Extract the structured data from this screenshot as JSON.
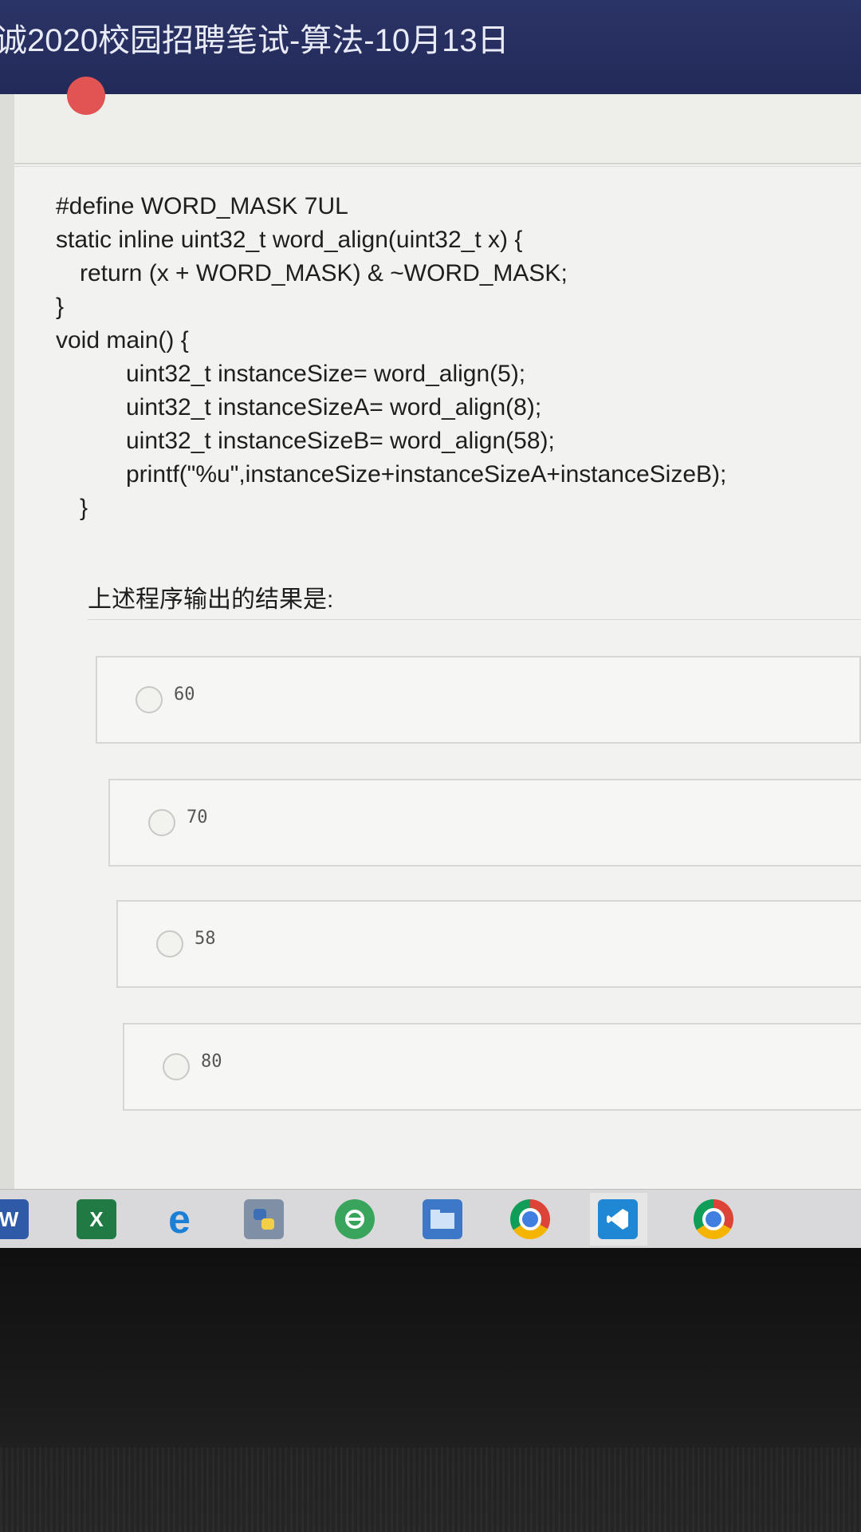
{
  "window": {
    "title": "诚2020校园招聘笔试-算法-10月13日"
  },
  "code_lines": [
    "#define WORD_MASK 7UL",
    "static inline uint32_t word_align(uint32_t x) {",
    "return (x + WORD_MASK) & ~WORD_MASK;",
    "}",
    "void main() {",
    "uint32_t instanceSize= word_align(5);",
    "uint32_t instanceSizeA= word_align(8);",
    "uint32_t instanceSizeB= word_align(58);",
    "printf(\"%u\",instanceSize+instanceSizeA+instanceSizeB);",
    "}"
  ],
  "question": "上述程序输出的结果是:",
  "options": [
    "60",
    "70",
    "58",
    "80"
  ],
  "taskbar": {
    "icons": [
      "word-icon",
      "excel-icon",
      "ie-icon",
      "python-icon",
      "ie-legacy-icon",
      "file-explorer-icon",
      "chrome-icon",
      "vscode-icon",
      "chrome-icon"
    ],
    "word_letter": "W",
    "excel_letter": "X",
    "ie_letter": "e"
  },
  "colors": {
    "titlebar": "#222a59",
    "page": "#f2f2f0",
    "taskbar": "#d9d9db"
  }
}
